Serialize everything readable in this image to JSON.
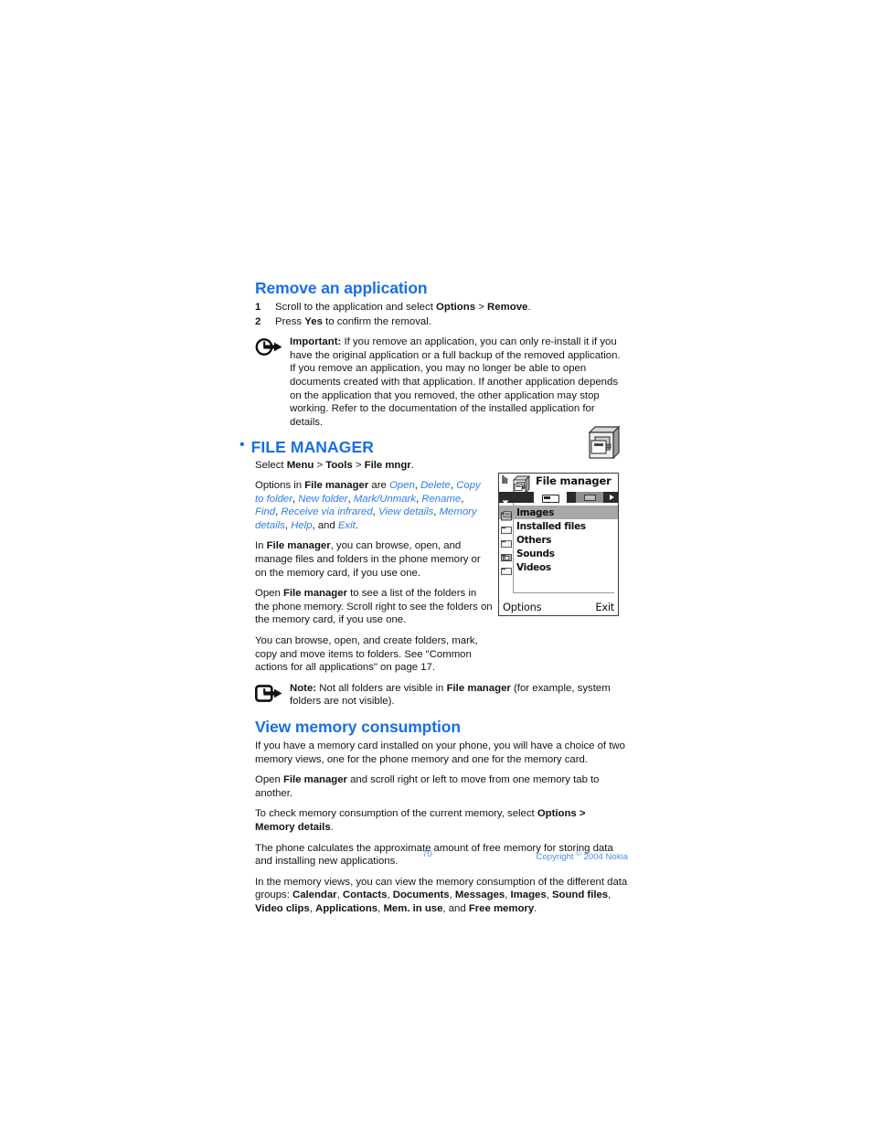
{
  "document": {
    "page_number": "70",
    "copyright_prefix": "Copyright ",
    "copyright_symbol": "©",
    "copyright_suffix": " 2004 Nokia"
  },
  "sections": {
    "remove_application": {
      "heading": "Remove an application",
      "steps": [
        {
          "number": "1",
          "text_before": "Scroll to the application and select ",
          "bold1": "Options",
          "mid": " > ",
          "bold2": "Remove",
          "text_after": "."
        },
        {
          "number": "2",
          "text_before": "Press ",
          "bold1": "Yes",
          "text_after": " to confirm the removal."
        }
      ],
      "important_note": {
        "icon": "pointing-hand-circle-icon",
        "label": "Important:",
        "text": " If you remove an application, you can only re-install it if you have the original application or a full backup of the removed application. If you remove an application, you may no longer be able to open documents created with that application. If another application depends on the application that you removed, the other application may stop working. Refer to the documentation of the installed application for details."
      }
    },
    "file_manager": {
      "bullet": "•",
      "heading": "FILE MANAGER",
      "icon": "file-cabinet-icon",
      "select_path": {
        "prefix": "Select ",
        "b1": "Menu",
        "sep1": " > ",
        "b2": "Tools",
        "sep2": " > ",
        "b3": "File mngr",
        "suffix": "."
      },
      "options_intro": {
        "prefix": "Options in ",
        "bold": "File manager",
        "are": " are "
      },
      "options": [
        "Open",
        "Delete",
        "Copy to folder",
        "New folder",
        "Mark/Unmark",
        "Rename",
        "Find",
        "Receive via infrared",
        "View details",
        "Memory details",
        "Help",
        "Exit"
      ],
      "options_and": ", and ",
      "options_end": ".",
      "paragraphs": [
        {
          "prefix": "In ",
          "bold": "File manager",
          "text": ", you can browse, open, and manage files and folders in the phone memory or on the memory card, if you use one."
        },
        {
          "prefix": "Open ",
          "bold": "File manager",
          "text": " to see a list of the folders in the phone memory. Scroll right to see the folders on the memory card, if you use one."
        },
        {
          "prefix": "",
          "bold": "",
          "text": "You can browse, open, and create folders, mark, copy and move items to folders. See \"Common actions for all applications\" on page 17."
        }
      ],
      "note": {
        "icon": "note-arrow-icon",
        "label": "Note:",
        "text_before": " Not all folders are visible in ",
        "bold": "File manager",
        "text_after": " (for example, system folders are not visible)."
      }
    },
    "view_memory": {
      "heading": "View memory consumption",
      "paragraphs": [
        {
          "prefix": "",
          "bold": "",
          "text": "If you have a memory card installed on your phone, you will have a choice of two memory views, one for the phone memory and one for the memory card."
        },
        {
          "prefix": "Open ",
          "bold": "File manager",
          "text": " and scroll right or left to move from one memory tab to another."
        }
      ],
      "memory_details_line": {
        "prefix": "To check memory consumption of the current memory, select ",
        "bold1": "Options >",
        "bold2": "Memory details",
        "suffix": "."
      },
      "calc_paragraph": "The phone calculates the approximate amount of free memory for storing data and installing new applications.",
      "groups_intro": "In the memory views, you can view the memory consumption of the different data groups: ",
      "groups": [
        "Calendar",
        "Contacts",
        "Documents",
        "Messages",
        "Images",
        "Sound files",
        "Video clips",
        "Applications",
        "Mem. in use"
      ],
      "groups_and": ", and ",
      "groups_last": "Free memory",
      "groups_end": "."
    }
  },
  "phone_screenshot": {
    "title": "File manager",
    "status_icons": [
      "signal-bars-icon",
      "file-manager-app-icon"
    ],
    "tabs": [
      {
        "name": "phone-memory-tab",
        "icon": "phone-memory-icon",
        "active": true
      },
      {
        "name": "memory-card-tab",
        "icon": "memory-card-icon",
        "active": false
      }
    ],
    "scroll_arrow": "right-arrow-icon",
    "items": [
      {
        "label": "Images",
        "icon": "folder-images-icon",
        "selected": true
      },
      {
        "label": "Installed files",
        "icon": "folder-icon",
        "selected": false
      },
      {
        "label": "Others",
        "icon": "folder-icon",
        "selected": false
      },
      {
        "label": "Sounds",
        "icon": "folder-sounds-icon",
        "selected": false
      },
      {
        "label": "Videos",
        "icon": "folder-icon",
        "selected": false
      }
    ],
    "softkeys": {
      "left": "Options",
      "right": "Exit"
    }
  },
  "colors": {
    "heading_blue": "#1a6ee6",
    "option_blue": "#2f7fe8",
    "footer_blue": "#4a8fe8",
    "selection_gray": "#a8a8a8",
    "tabbar_dark": "#2b2b2b"
  }
}
